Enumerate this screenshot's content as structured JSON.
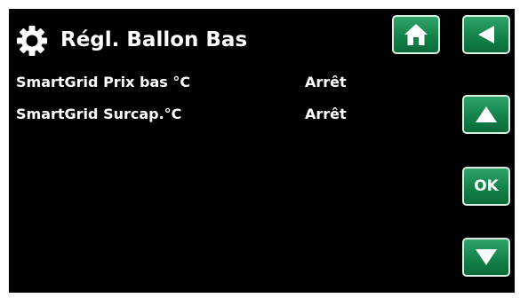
{
  "header": {
    "title": "Régl. Ballon Bas",
    "icon": "gear-icon"
  },
  "settings": [
    {
      "label": "SmartGrid Prix bas °C",
      "value": "Arrêt"
    },
    {
      "label": "SmartGrid Surcap.°C",
      "value": "Arrêt"
    }
  ],
  "buttons": {
    "home": "home-icon",
    "back": "back-arrow-icon",
    "up": "up-arrow-icon",
    "ok_label": "OK",
    "down": "down-arrow-icon"
  },
  "colors": {
    "background": "#000000",
    "button": "#128048",
    "text": "#ffffff"
  }
}
